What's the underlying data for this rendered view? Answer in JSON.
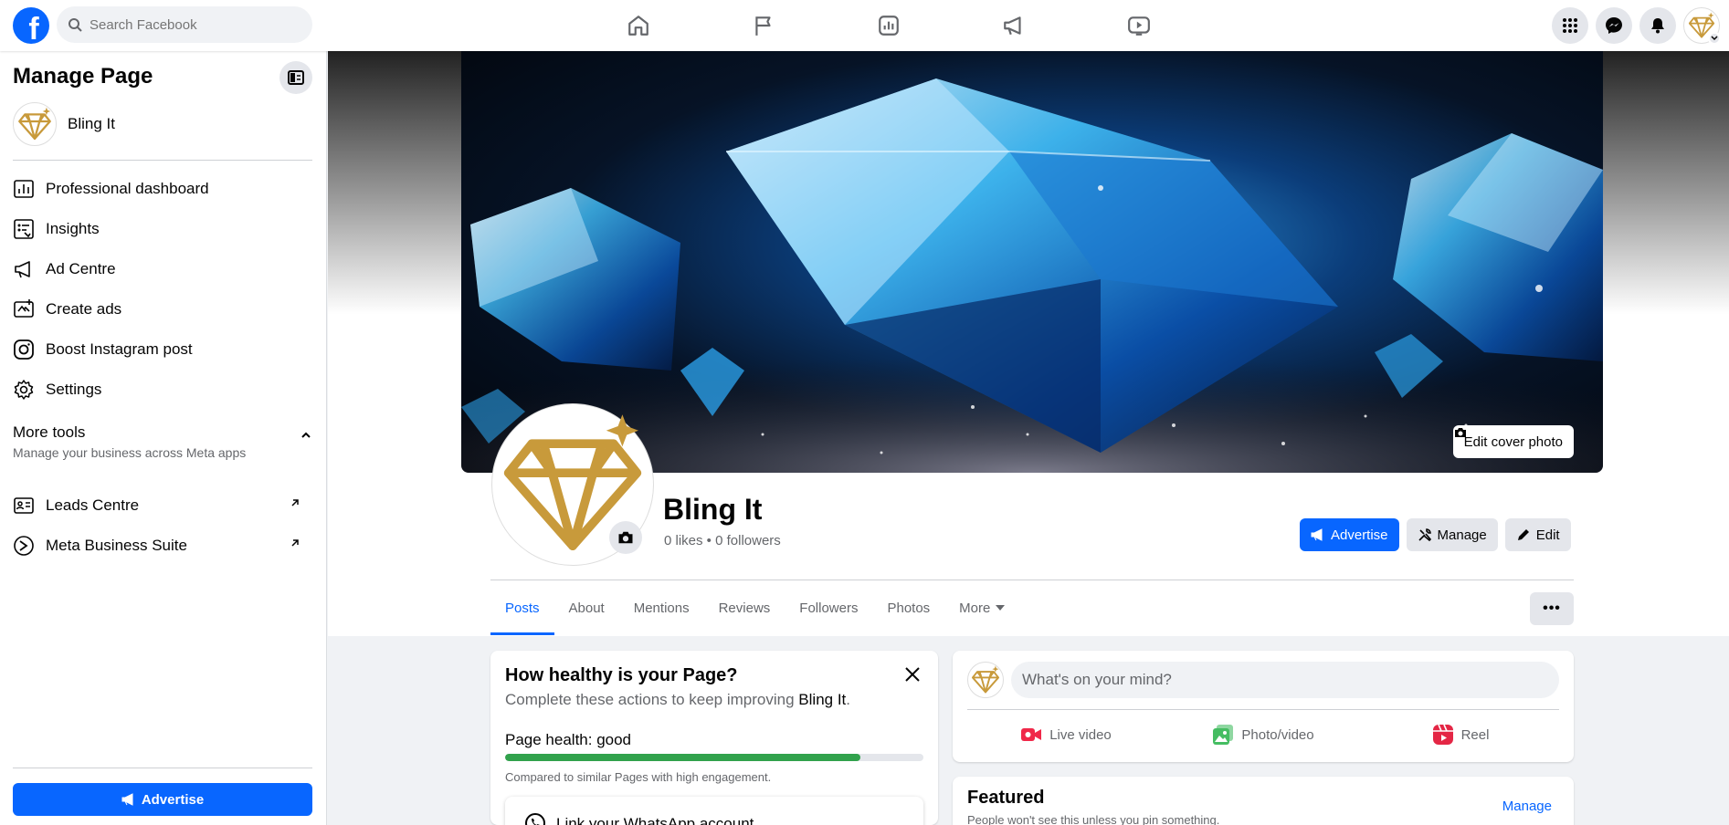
{
  "topbar": {
    "logo": "f",
    "search_placeholder": "Search Facebook",
    "nav_icons": [
      "home-icon",
      "pages-flag-icon",
      "dashboard-icon",
      "ad-centre-megaphone-icon",
      "video-icon"
    ],
    "right_icons": [
      "menu-grid-icon",
      "messenger-icon",
      "notifications-bell-icon"
    ]
  },
  "sidebar": {
    "title": "Manage Page",
    "page_name": "Bling It",
    "items": [
      {
        "label": "Professional dashboard",
        "icon": "dashboard-icon"
      },
      {
        "label": "Insights",
        "icon": "insights-icon"
      },
      {
        "label": "Ad Centre",
        "icon": "megaphone-icon"
      },
      {
        "label": "Create ads",
        "icon": "create-ads-icon"
      },
      {
        "label": "Boost Instagram post",
        "icon": "instagram-icon"
      },
      {
        "label": "Settings",
        "icon": "gear-icon"
      }
    ],
    "more_tools": {
      "title": "More tools",
      "subtitle": "Manage your business across Meta apps"
    },
    "tools": [
      {
        "label": "Leads Centre",
        "icon": "leads-icon"
      },
      {
        "label": "Meta Business Suite",
        "icon": "meta-business-icon"
      }
    ],
    "advertise_label": "Advertise"
  },
  "profile": {
    "edit_cover_label": "Edit cover photo",
    "name": "Bling It",
    "stats": "0 likes • 0 followers",
    "advertise_label": "Advertise",
    "manage_label": "Manage",
    "edit_label": "Edit",
    "more_label": "•••"
  },
  "tabs": [
    {
      "label": "Posts",
      "active": true
    },
    {
      "label": "About"
    },
    {
      "label": "Mentions"
    },
    {
      "label": "Reviews"
    },
    {
      "label": "Followers"
    },
    {
      "label": "Photos"
    },
    {
      "label": "More"
    }
  ],
  "health_card": {
    "title": "How healthy is your Page?",
    "subtitle_prefix": "Complete these actions to keep improving ",
    "subtitle_page": "Bling It",
    "subtitle_suffix": ".",
    "health_label": "Page health: good",
    "progress": 0.85,
    "progress_color": "#31a24c",
    "comparison": "Compared to similar Pages with high engagement.",
    "whatsapp_label": "Link your WhatsApp account"
  },
  "composer": {
    "placeholder": "What's on your mind?",
    "options": [
      {
        "label": "Live video",
        "icon": "live-video-icon",
        "color": "#f02849"
      },
      {
        "label": "Photo/video",
        "icon": "photo-video-icon",
        "color": "#45bd62"
      },
      {
        "label": "Reel",
        "icon": "reel-icon",
        "color": "#e42645"
      }
    ]
  },
  "featured": {
    "title": "Featured",
    "subtitle": "People won't see this unless you pin something.",
    "manage_label": "Manage"
  },
  "colors": {
    "brand": "#0866ff",
    "gold": "#c89a3b",
    "background": "#f0f2f5"
  }
}
